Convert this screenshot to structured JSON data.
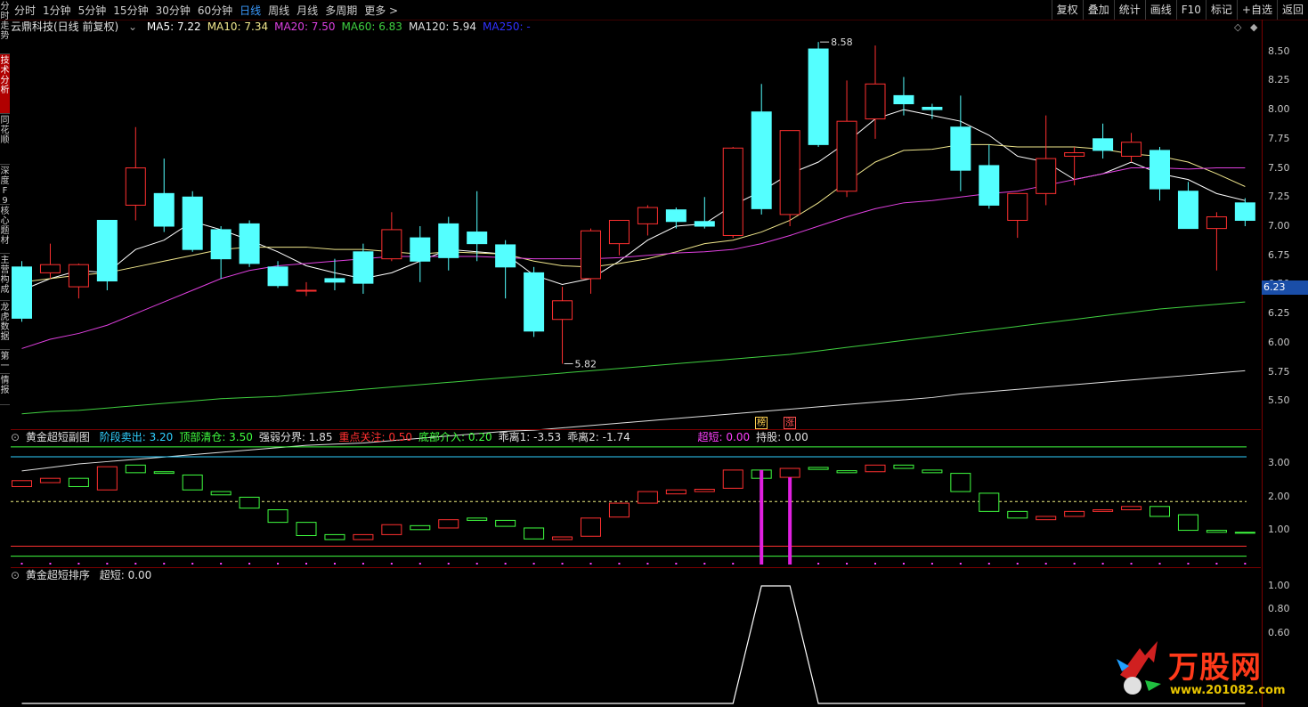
{
  "topbar": {
    "periods": [
      "分时",
      "1分钟",
      "5分钟",
      "15分钟",
      "30分钟",
      "60分钟",
      "日线",
      "周线",
      "月线",
      "多周期",
      "更多 >"
    ],
    "active_period": "日线",
    "tools": [
      "复权",
      "叠加",
      "统计",
      "画线",
      "F10",
      "标记",
      "+自选",
      "返回"
    ]
  },
  "sidebar": [
    "分时走势",
    "技术分析",
    "同花顺",
    "深度F9",
    "核心题材",
    "主营构成",
    "龙虎数据",
    "第一",
    "情报"
  ],
  "main": {
    "stock_name": "云鼎科技(日线 前复权)",
    "ma": [
      {
        "label": "MA5: 7.22",
        "color": "#ffffff"
      },
      {
        "label": "MA10: 7.34",
        "color": "#f0e68c"
      },
      {
        "label": "MA20: 7.50",
        "color": "#e040e0"
      },
      {
        "label": "MA60: 6.83",
        "color": "#40d040"
      },
      {
        "label": "MA120: 5.94",
        "color": "#e0e0e0"
      },
      {
        "label": "MA250: -",
        "color": "#3030ff"
      }
    ],
    "y_ticks": [
      "8.50",
      "8.25",
      "8.00",
      "7.75",
      "7.50",
      "7.25",
      "7.00",
      "6.75",
      "6.50",
      "6.25",
      "6.00",
      "5.75",
      "5.50"
    ],
    "high_label": "8.58",
    "low_label": "5.82",
    "current_price": "6.23",
    "marks": [
      {
        "text": "榜",
        "color": "#ffd050"
      },
      {
        "text": "涨",
        "color": "#ff5050"
      }
    ]
  },
  "sub1": {
    "title": "黄金超短副图",
    "items": [
      {
        "label": "阶段卖出: 3.20",
        "color": "#30d0ff"
      },
      {
        "label": "顶部清仓: 3.50",
        "color": "#40ff40"
      },
      {
        "label": "强弱分界: 1.85",
        "color": "#e0e0e0"
      },
      {
        "label": "重点关注: 0.50",
        "color": "#ff3030"
      },
      {
        "label": "底部介入: 0.20",
        "color": "#40ff40"
      },
      {
        "label": "乖离1: -3.53",
        "color": "#e0e0e0"
      },
      {
        "label": "乖离2: -1.74",
        "color": "#e0e0e0"
      }
    ],
    "extra": [
      {
        "label": "超短: 0.00",
        "color": "#ff40ff"
      },
      {
        "label": "持股: 0.00",
        "color": "#e0e0e0"
      }
    ],
    "y_ticks": [
      "3.00",
      "2.00",
      "1.00"
    ]
  },
  "sub2": {
    "title": "黄金超短排序",
    "items": [
      {
        "label": "超短: 0.00",
        "color": "#e0e0e0"
      }
    ],
    "y_ticks": [
      "1.00",
      "0.80",
      "0.60"
    ]
  },
  "chart_data": {
    "type": "candlestick",
    "ylim": [
      5.35,
      8.65
    ],
    "candles": [
      {
        "o": 6.65,
        "h": 6.7,
        "l": 6.18,
        "c": 6.21
      },
      {
        "o": 6.6,
        "h": 6.85,
        "l": 6.55,
        "c": 6.67
      },
      {
        "o": 6.48,
        "h": 6.68,
        "l": 6.38,
        "c": 6.67
      },
      {
        "o": 7.05,
        "h": 7.05,
        "l": 6.45,
        "c": 6.53
      },
      {
        "o": 7.18,
        "h": 7.85,
        "l": 7.05,
        "c": 7.5
      },
      {
        "o": 7.28,
        "h": 7.58,
        "l": 6.95,
        "c": 7.0
      },
      {
        "o": 7.25,
        "h": 7.3,
        "l": 6.78,
        "c": 6.8
      },
      {
        "o": 6.97,
        "h": 7.0,
        "l": 6.55,
        "c": 6.72
      },
      {
        "o": 7.02,
        "h": 7.05,
        "l": 6.65,
        "c": 6.68
      },
      {
        "o": 6.65,
        "h": 6.7,
        "l": 6.47,
        "c": 6.49
      },
      {
        "o": 6.45,
        "h": 6.52,
        "l": 6.4,
        "c": 6.45
      },
      {
        "o": 6.55,
        "h": 6.72,
        "l": 6.45,
        "c": 6.52
      },
      {
        "o": 6.78,
        "h": 6.85,
        "l": 6.42,
        "c": 6.51
      },
      {
        "o": 6.72,
        "h": 7.12,
        "l": 6.7,
        "c": 6.97
      },
      {
        "o": 6.9,
        "h": 7.0,
        "l": 6.52,
        "c": 6.7
      },
      {
        "o": 7.02,
        "h": 7.08,
        "l": 6.62,
        "c": 6.73
      },
      {
        "o": 6.95,
        "h": 7.3,
        "l": 6.7,
        "c": 6.85
      },
      {
        "o": 6.84,
        "h": 6.88,
        "l": 6.38,
        "c": 6.65
      },
      {
        "o": 6.6,
        "h": 6.65,
        "l": 6.05,
        "c": 6.1
      },
      {
        "o": 6.2,
        "h": 6.48,
        "l": 5.82,
        "c": 6.36
      },
      {
        "o": 6.55,
        "h": 6.98,
        "l": 6.42,
        "c": 6.96
      },
      {
        "o": 6.85,
        "h": 7.05,
        "l": 6.75,
        "c": 7.05
      },
      {
        "o": 7.02,
        "h": 7.18,
        "l": 6.92,
        "c": 7.16
      },
      {
        "o": 7.14,
        "h": 7.16,
        "l": 6.98,
        "c": 7.04
      },
      {
        "o": 7.04,
        "h": 7.25,
        "l": 6.98,
        "c": 7.0
      },
      {
        "o": 6.92,
        "h": 7.68,
        "l": 6.9,
        "c": 7.67
      },
      {
        "o": 7.98,
        "h": 8.22,
        "l": 7.1,
        "c": 7.15
      },
      {
        "o": 7.1,
        "h": 7.82,
        "l": 7.0,
        "c": 7.82
      },
      {
        "o": 8.52,
        "h": 8.58,
        "l": 7.68,
        "c": 7.7
      },
      {
        "o": 7.3,
        "h": 8.25,
        "l": 7.25,
        "c": 7.9
      },
      {
        "o": 7.92,
        "h": 8.55,
        "l": 7.75,
        "c": 8.22
      },
      {
        "o": 8.12,
        "h": 8.28,
        "l": 7.95,
        "c": 8.05
      },
      {
        "o": 8.02,
        "h": 8.05,
        "l": 7.92,
        "c": 8.0
      },
      {
        "o": 7.85,
        "h": 8.12,
        "l": 7.3,
        "c": 7.48
      },
      {
        "o": 7.52,
        "h": 7.7,
        "l": 7.15,
        "c": 7.18
      },
      {
        "o": 7.05,
        "h": 7.28,
        "l": 6.9,
        "c": 7.28
      },
      {
        "o": 7.28,
        "h": 7.95,
        "l": 7.18,
        "c": 7.58
      },
      {
        "o": 7.6,
        "h": 7.68,
        "l": 7.35,
        "c": 7.63
      },
      {
        "o": 7.75,
        "h": 7.88,
        "l": 7.58,
        "c": 7.65
      },
      {
        "o": 7.6,
        "h": 7.8,
        "l": 7.55,
        "c": 7.72
      },
      {
        "o": 7.65,
        "h": 7.68,
        "l": 7.22,
        "c": 7.32
      },
      {
        "o": 7.3,
        "h": 7.38,
        "l": 6.98,
        "c": 6.98
      },
      {
        "o": 6.98,
        "h": 7.12,
        "l": 6.62,
        "c": 7.08
      },
      {
        "o": 7.2,
        "h": 7.24,
        "l": 7.0,
        "c": 7.05
      }
    ],
    "ma_lines": {
      "MA5": [
        6.45,
        6.55,
        6.62,
        6.6,
        6.8,
        6.88,
        7.04,
        6.97,
        6.88,
        6.78,
        6.66,
        6.6,
        6.55,
        6.6,
        6.7,
        6.8,
        6.78,
        6.76,
        6.58,
        6.5,
        6.55,
        6.7,
        6.88,
        7.0,
        7.02,
        7.18,
        7.3,
        7.45,
        7.55,
        7.72,
        7.92,
        8.0,
        7.95,
        7.9,
        7.78,
        7.6,
        7.55,
        7.4,
        7.45,
        7.55,
        7.45,
        7.4,
        7.28,
        7.22
      ],
      "MA10": [
        6.52,
        6.55,
        6.58,
        6.6,
        6.65,
        6.7,
        6.75,
        6.8,
        6.82,
        6.82,
        6.82,
        6.8,
        6.8,
        6.78,
        6.76,
        6.78,
        6.77,
        6.76,
        6.7,
        6.66,
        6.65,
        6.68,
        6.72,
        6.78,
        6.85,
        6.88,
        6.95,
        7.05,
        7.2,
        7.38,
        7.55,
        7.65,
        7.66,
        7.7,
        7.7,
        7.68,
        7.68,
        7.68,
        7.66,
        7.62,
        7.6,
        7.55,
        7.45,
        7.34
      ],
      "MA20": [
        5.95,
        6.03,
        6.08,
        6.15,
        6.25,
        6.35,
        6.45,
        6.55,
        6.62,
        6.66,
        6.68,
        6.7,
        6.72,
        6.74,
        6.74,
        6.74,
        6.74,
        6.73,
        6.72,
        6.72,
        6.72,
        6.73,
        6.75,
        6.77,
        6.78,
        6.8,
        6.85,
        6.92,
        7.0,
        7.08,
        7.15,
        7.2,
        7.22,
        7.25,
        7.28,
        7.3,
        7.35,
        7.4,
        7.45,
        7.5,
        7.5,
        7.49,
        7.5,
        7.5
      ],
      "MA60": [
        5.39,
        5.41,
        5.42,
        5.44,
        5.46,
        5.48,
        5.5,
        5.52,
        5.53,
        5.54,
        5.56,
        5.58,
        5.6,
        5.62,
        5.64,
        5.66,
        5.68,
        5.7,
        5.72,
        5.74,
        5.76,
        5.78,
        5.8,
        5.82,
        5.84,
        5.86,
        5.88,
        5.9,
        5.93,
        5.96,
        5.99,
        6.02,
        6.05,
        6.08,
        6.11,
        6.14,
        6.17,
        6.2,
        6.23,
        6.26,
        6.29,
        6.31,
        6.33,
        6.35
      ],
      "MA120": [
        4.9,
        4.93,
        4.96,
        4.98,
        5.0,
        5.02,
        5.04,
        5.06,
        5.08,
        5.1,
        5.12,
        5.13,
        5.14,
        5.16,
        5.18,
        5.2,
        5.22,
        5.24,
        5.25,
        5.27,
        5.29,
        5.31,
        5.33,
        5.35,
        5.37,
        5.39,
        5.41,
        5.43,
        5.45,
        5.47,
        5.49,
        5.51,
        5.53,
        5.56,
        5.58,
        5.6,
        5.62,
        5.64,
        5.66,
        5.68,
        5.7,
        5.72,
        5.74,
        5.76
      ]
    },
    "sub1_ylim": [
      0.0,
      3.55
    ],
    "sub1_bars": [
      {
        "o": 2.3,
        "c": 2.48
      },
      {
        "o": 2.42,
        "c": 2.55
      },
      {
        "o": 2.55,
        "c": 2.3
      },
      {
        "o": 2.2,
        "c": 2.9
      },
      {
        "o": 2.95,
        "c": 2.72
      },
      {
        "o": 2.75,
        "c": 2.7
      },
      {
        "o": 2.65,
        "c": 2.2
      },
      {
        "o": 2.15,
        "c": 2.05
      },
      {
        "o": 1.98,
        "c": 1.65
      },
      {
        "o": 1.6,
        "c": 1.22
      },
      {
        "o": 1.22,
        "c": 0.82
      },
      {
        "o": 0.85,
        "c": 0.7
      },
      {
        "o": 0.7,
        "c": 0.85
      },
      {
        "o": 0.85,
        "c": 1.15
      },
      {
        "o": 1.12,
        "c": 1.0
      },
      {
        "o": 1.05,
        "c": 1.3
      },
      {
        "o": 1.35,
        "c": 1.28
      },
      {
        "o": 1.28,
        "c": 1.1
      },
      {
        "o": 1.05,
        "c": 0.72
      },
      {
        "o": 0.7,
        "c": 0.78
      },
      {
        "o": 0.8,
        "c": 1.35
      },
      {
        "o": 1.38,
        "c": 1.8
      },
      {
        "o": 1.8,
        "c": 2.15
      },
      {
        "o": 2.08,
        "c": 2.2
      },
      {
        "o": 2.15,
        "c": 2.22
      },
      {
        "o": 2.25,
        "c": 2.8
      },
      {
        "o": 2.8,
        "c": 2.55
      },
      {
        "o": 2.58,
        "c": 2.85
      },
      {
        "o": 2.88,
        "c": 2.82
      },
      {
        "o": 2.78,
        "c": 2.72
      },
      {
        "o": 2.75,
        "c": 2.95
      },
      {
        "o": 2.95,
        "c": 2.85
      },
      {
        "o": 2.8,
        "c": 2.72
      },
      {
        "o": 2.7,
        "c": 2.15
      },
      {
        "o": 2.1,
        "c": 1.55
      },
      {
        "o": 1.55,
        "c": 1.35
      },
      {
        "o": 1.3,
        "c": 1.4
      },
      {
        "o": 1.4,
        "c": 1.55
      },
      {
        "o": 1.55,
        "c": 1.6
      },
      {
        "o": 1.6,
        "c": 1.7
      },
      {
        "o": 1.7,
        "c": 1.4
      },
      {
        "o": 1.45,
        "c": 0.98
      },
      {
        "o": 0.98,
        "c": 0.92
      },
      {
        "o": 0.92,
        "c": 0.9
      }
    ],
    "sub1_levels": {
      "sell": 3.2,
      "clear": 3.5,
      "divide": 1.85,
      "focus": 0.5,
      "bottom": 0.2
    },
    "sub1_signals": [
      26,
      27
    ],
    "sub2_ylim": [
      0.0,
      1.0
    ],
    "sub2_line": [
      0,
      0,
      0,
      0,
      0,
      0,
      0,
      0,
      0,
      0,
      0,
      0,
      0,
      0,
      0,
      0,
      0,
      0,
      0,
      0,
      0,
      0,
      0,
      0,
      0,
      0,
      1,
      1,
      0,
      0,
      0,
      0,
      0,
      0,
      0,
      0,
      0,
      0,
      0,
      0,
      0,
      0,
      0,
      0
    ]
  },
  "watermark": {
    "name": "万股网",
    "url": "www.201082.com"
  }
}
